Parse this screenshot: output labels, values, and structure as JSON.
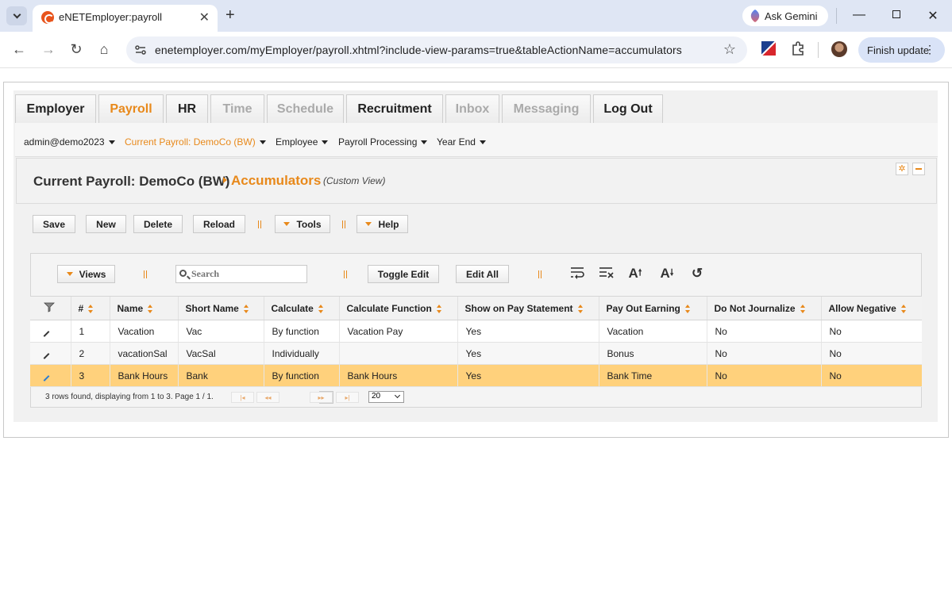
{
  "browser": {
    "tab_title": "eNETEmployer:payroll",
    "url": "enetemployer.com/myEmployer/payroll.xhtml?include-view-params=true&tableActionName=accumulators",
    "ask_gemini": "Ask Gemini",
    "finish_update": "Finish update"
  },
  "menu": {
    "tabs": [
      {
        "label": "Employer",
        "state": "normal"
      },
      {
        "label": "Payroll",
        "state": "active"
      },
      {
        "label": "HR",
        "state": "normal"
      },
      {
        "label": "Time",
        "state": "disabled"
      },
      {
        "label": "Schedule",
        "state": "disabled"
      },
      {
        "label": "Recruitment",
        "state": "normal"
      },
      {
        "label": "Inbox",
        "state": "disabled"
      },
      {
        "label": "Messaging",
        "state": "disabled"
      },
      {
        "label": "Log Out",
        "state": "normal"
      }
    ]
  },
  "submenu": {
    "user": "admin@demo2023",
    "current_payroll": "Current Payroll: DemoCo (BW)",
    "employee": "Employee",
    "payroll_processing": "Payroll Processing",
    "year_end": "Year End"
  },
  "title": {
    "main": "Current Payroll: DemoCo (BW)",
    "sub": "Accumulators",
    "note": "(Custom View)"
  },
  "actions": {
    "save": "Save",
    "new": "New",
    "delete": "Delete",
    "reload": "Reload",
    "tools": "Tools",
    "help": "Help"
  },
  "grid_toolbar": {
    "views": "Views",
    "search_placeholder": "Search",
    "toggle_edit": "Toggle Edit",
    "edit_all": "Edit All"
  },
  "table": {
    "columns": [
      "#",
      "Name",
      "Short Name",
      "Calculate",
      "Calculate Function",
      "Show on Pay Statement",
      "Pay Out Earning",
      "Do Not Journalize",
      "Allow Negative"
    ],
    "rows": [
      {
        "num": "1",
        "name": "Vacation",
        "short_name": "Vac",
        "calculate": "By function",
        "calc_function": "Vacation Pay",
        "show_on_pay": "Yes",
        "pay_out": "Vacation",
        "no_journal": "No",
        "allow_neg": "No"
      },
      {
        "num": "2",
        "name": "vacationSal",
        "short_name": "VacSal",
        "calculate": "Individually",
        "calc_function": "",
        "show_on_pay": "Yes",
        "pay_out": "Bonus",
        "no_journal": "No",
        "allow_neg": "No"
      },
      {
        "num": "3",
        "name": "Bank Hours",
        "short_name": "Bank",
        "calculate": "By function",
        "calc_function": "Bank Hours",
        "show_on_pay": "Yes",
        "pay_out": "Bank Time",
        "no_journal": "No",
        "allow_neg": "No"
      }
    ],
    "selected_row": 3
  },
  "pager": {
    "summary": "3 rows found, displaying from 1 to 3. Page 1 / 1.",
    "current_page": "1",
    "page_size": "20"
  },
  "colors": {
    "accent": "#e8891b",
    "selected_row": "#ffd17c"
  }
}
